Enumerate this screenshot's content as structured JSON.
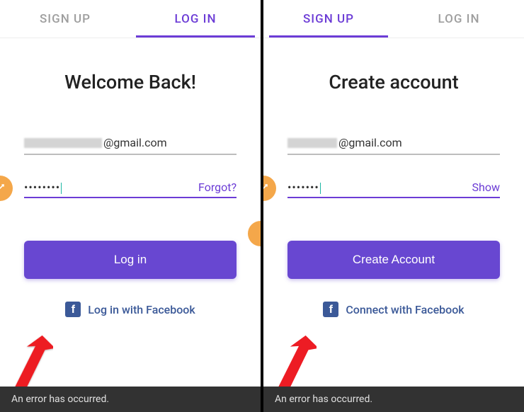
{
  "left": {
    "tabs": {
      "signup": "SIGN UP",
      "login": "LOG IN"
    },
    "heading": "Welcome Back!",
    "email_suffix": "@gmail.com",
    "password_mask": "••••••••",
    "forgot": "Forgot?",
    "primary": "Log in",
    "fb": "Log in with Facebook",
    "toast": "An error has occurred."
  },
  "right": {
    "tabs": {
      "signup": "SIGN UP",
      "login": "LOG IN"
    },
    "heading": "Create account",
    "email_suffix": "@gmail.com",
    "password_mask": "•••••••",
    "show": "Show",
    "primary": "Create Account",
    "fb": "Connect with Facebook",
    "toast": "An error has occurred."
  },
  "colors": {
    "accent": "#6c3cd6",
    "button": "#6847d1",
    "fb": "#3b5998",
    "toast": "#323232"
  }
}
